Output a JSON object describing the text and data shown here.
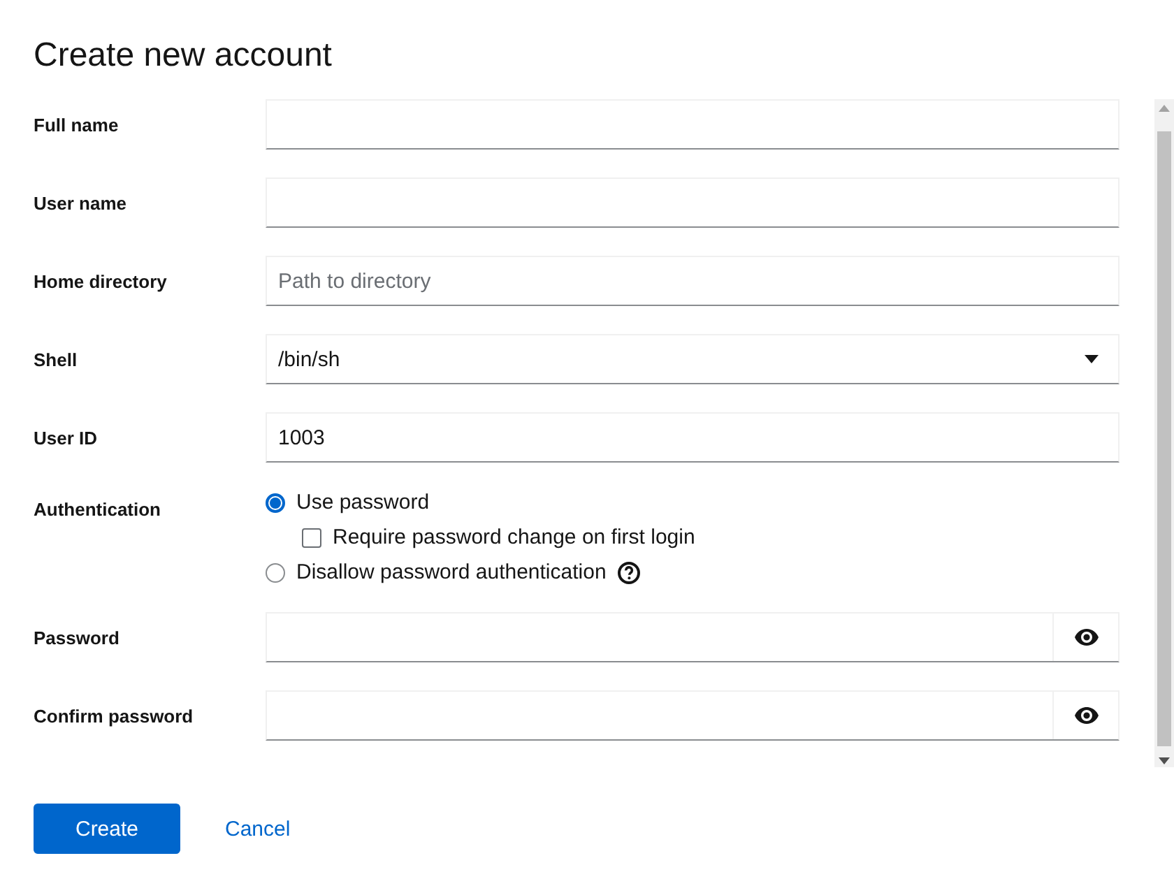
{
  "dialog": {
    "title": "Create new account"
  },
  "fields": [
    {
      "kind": "text",
      "label": "Full name"
    },
    {
      "kind": "text",
      "label": "User name"
    },
    {
      "kind": "text",
      "label": "Home directory",
      "placeholder": "Path to directory"
    },
    {
      "kind": "select",
      "label": "Shell",
      "value": "/bin/sh"
    },
    {
      "kind": "text",
      "label": "User ID",
      "value": "1003"
    },
    {
      "kind": "radios",
      "label": "Authentication",
      "options": [
        {
          "label": "Use password",
          "selected": true,
          "help": false,
          "children": [
            {
              "label": "Require password change on first login",
              "checked": false
            }
          ]
        },
        {
          "label": "Disallow password authentication",
          "selected": false,
          "help": true
        }
      ]
    },
    {
      "kind": "password",
      "label": "Password"
    },
    {
      "kind": "password",
      "label": "Confirm password"
    }
  ],
  "buttons": [
    {
      "kind": "primary",
      "label": "Create"
    },
    {
      "kind": "link",
      "label": "Cancel"
    }
  ]
}
